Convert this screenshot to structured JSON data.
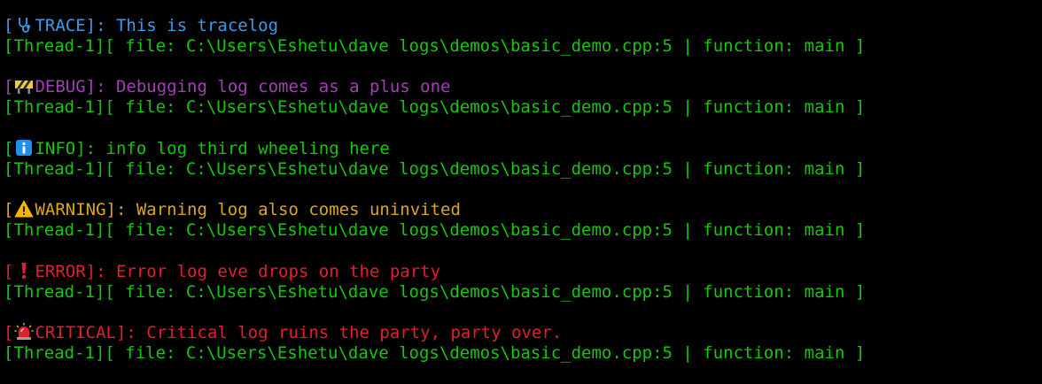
{
  "colors": {
    "trace": "#3b9be9",
    "debug": "#a33fb5",
    "info": "#16c60c",
    "warning": "#d9a621",
    "error": "#e0202e",
    "critical": "#e0202e",
    "meta": "#16c60c",
    "background": "#000000"
  },
  "logs": [
    {
      "open": "[",
      "icon": "stethoscope-icon",
      "level": "TRACE",
      "close": "]: ",
      "message": "This is tracelog",
      "meta": "[Thread-1][ file: C:\\Users\\Eshetu\\dave logs\\demos\\basic_demo.cpp:5 | function: main ]"
    },
    {
      "open": "[",
      "icon": "construction-barrier-icon",
      "level": "DEBUG",
      "close": "]: ",
      "message": "Debugging log comes as a plus one",
      "meta": "[Thread-1][ file: C:\\Users\\Eshetu\\dave logs\\demos\\basic_demo.cpp:5 | function: main ]"
    },
    {
      "open": "[",
      "icon": "info-icon",
      "level": "INFO",
      "close": "]: ",
      "message": "info log third wheeling here",
      "meta": "[Thread-1][ file: C:\\Users\\Eshetu\\dave logs\\demos\\basic_demo.cpp:5 | function: main ]"
    },
    {
      "open": "[",
      "icon": "warning-icon",
      "level": "WARNING",
      "close": "]: ",
      "message": "Warning log also comes uninvited",
      "meta": "[Thread-1][ file: C:\\Users\\Eshetu\\dave logs\\demos\\basic_demo.cpp:5 | function: main ]"
    },
    {
      "open": "[",
      "icon": "exclamation-icon",
      "level": "ERROR",
      "close": "]: ",
      "message": "Error log eve drops on the party",
      "meta": "[Thread-1][ file: C:\\Users\\Eshetu\\dave logs\\demos\\basic_demo.cpp:5 | function: main ]"
    },
    {
      "open": "[",
      "icon": "siren-icon",
      "level": "CRITICAL",
      "close": "]: ",
      "message": "Critical log ruins the party, party over.",
      "meta": "[Thread-1][ file: C:\\Users\\Eshetu\\dave logs\\demos\\basic_demo.cpp:5 | function: main ]"
    }
  ]
}
